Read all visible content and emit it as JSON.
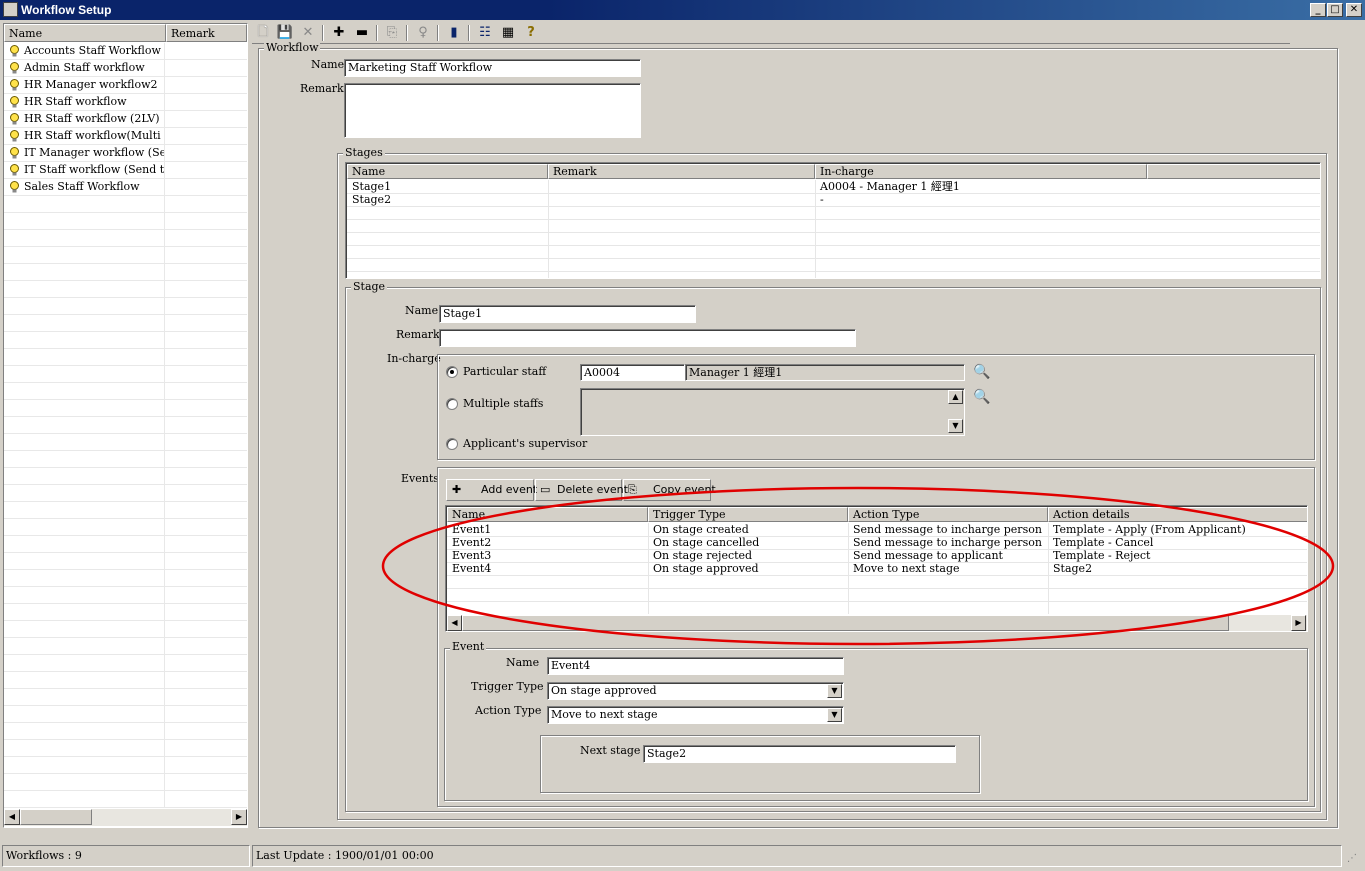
{
  "window": {
    "title": "Workflow Setup",
    "min": "_",
    "max": "□",
    "close": "✕"
  },
  "list": {
    "headers": [
      "Name",
      "Remark"
    ],
    "items": [
      "Accounts Staff Workflow",
      "Admin Staff workflow",
      "HR Manager workflow2",
      "HR Staff workflow",
      "HR Staff workflow (2LV)",
      "HR Staff workflow(Multi A...",
      "IT Manager workflow (Sen...",
      "IT Staff workflow (Send to ...",
      "Sales Staff Workflow"
    ]
  },
  "toolbar": {
    "icons": [
      "new-icon",
      "save-icon",
      "delete-icon",
      "add-icon",
      "remove-icon",
      "copy-icon",
      "hint-icon",
      "exit-icon",
      "list-view-icon",
      "grid-view-icon",
      "help-icon"
    ]
  },
  "workflow": {
    "group_title": "Workflow",
    "name_label": "Name",
    "name_value": "Marketing Staff Workflow",
    "remark_label": "Remark",
    "remark_value": ""
  },
  "stages": {
    "group_title": "Stages",
    "headers": [
      "Name",
      "Remark",
      "In-charge",
      ""
    ],
    "rows": [
      [
        "Stage1",
        "",
        "A0004 - Manager 1 經理1"
      ],
      [
        "Stage2",
        "",
        " -"
      ]
    ]
  },
  "stage": {
    "group_title": "Stage",
    "name_label": "Name",
    "name_value": "Stage1",
    "remark_label": "Remark",
    "remark_value": "",
    "incharge_label": "In-charge",
    "opt_particular": "Particular staff",
    "opt_multiple": "Multiple staffs",
    "opt_supervisor": "Applicant's supervisor",
    "staff_code": "A0004",
    "staff_name": "Manager 1 經理1",
    "events_label": "Events",
    "btn_add": "Add event",
    "btn_delete": "Delete event",
    "btn_copy": "Copy event"
  },
  "events": {
    "headers": [
      "Name",
      "Trigger Type",
      "Action Type",
      "Action details"
    ],
    "rows": [
      [
        "Event1",
        "On stage created",
        "Send message to incharge person",
        "Template - Apply (From Applicant)"
      ],
      [
        "Event2",
        "On stage cancelled",
        "Send message to incharge person",
        "Template - Cancel"
      ],
      [
        "Event3",
        "On stage rejected",
        "Send message to applicant",
        "Template - Reject"
      ],
      [
        "Event4",
        "On stage approved",
        "Move to next stage",
        "Stage2"
      ]
    ]
  },
  "event": {
    "group_title": "Event",
    "name_label": "Name",
    "name_value": "Event4",
    "trigger_label": "Trigger Type",
    "trigger_value": "On stage approved",
    "action_label": "Action Type",
    "action_value": "Move to next stage",
    "next_stage_label": "Next stage",
    "next_stage_value": "Stage2"
  },
  "status": {
    "count": "Workflows : 9",
    "last_update": "Last Update :  1900/01/01 00:00"
  },
  "colors": {
    "titlebar": "#0a246a",
    "highlight_ellipse": "#e00000",
    "face": "#d4d0c8"
  }
}
